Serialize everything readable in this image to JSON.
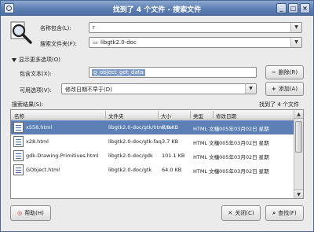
{
  "window": {
    "title": "找到了 4 个文件 - 搜索文件",
    "controls": {
      "minimize": "_",
      "maximize": "□",
      "close": "×"
    }
  },
  "form": {
    "name_label": "名称包含(L):",
    "name_value": "r",
    "folder_label": "搜索文件夹(F):",
    "folder_value": "libgtk2.0-doc",
    "folder_icon": "folder-icon"
  },
  "options": {
    "header": "显示更多选项(O)",
    "contains_text_label": "包含文本(X):",
    "contains_text_value": "g_object_get_data",
    "add_button": "删除(R)",
    "available_label": "可用选项(V):",
    "available_value": "修改日期不早于(D)",
    "add_option_button": "添加(A)"
  },
  "results": {
    "label": "搜索结果(S):",
    "count": "找到了 4 个文件",
    "columns": [
      "名称",
      "文件夹",
      "大小",
      "类型",
      "修改日期"
    ],
    "rows": [
      {
        "name": "x558.html",
        "folder": "libgtk2.0-doc/gtk/html/ta",
        "size": "8.9 KB",
        "type": "HTML 文档",
        "date": "2005年03月02日 星期",
        "selected": true
      },
      {
        "name": "x28.html",
        "folder": "libgtk2.0-doc/gtk-faq",
        "size": "3.7 KB",
        "type": "HTML 文档",
        "date": "2005年03月02日 星期",
        "selected": false
      },
      {
        "name": "gdk-Drawing-Primitives.html",
        "folder": "libgtk2.0-doc/gdk",
        "size": "101.1 KB",
        "type": "HTML 文档",
        "date": "2005年03月02日 星期",
        "selected": false
      },
      {
        "name": "GObject.html",
        "folder": "libgtk2.0-doc/gtk",
        "size": "64.0 KB",
        "type": "HTML 文档",
        "date": "2005年03月02日 星期",
        "selected": false
      }
    ]
  },
  "footer": {
    "help_button": "帮助(H)",
    "close_button": "关闭(C)",
    "find_button": "查找(F)"
  }
}
